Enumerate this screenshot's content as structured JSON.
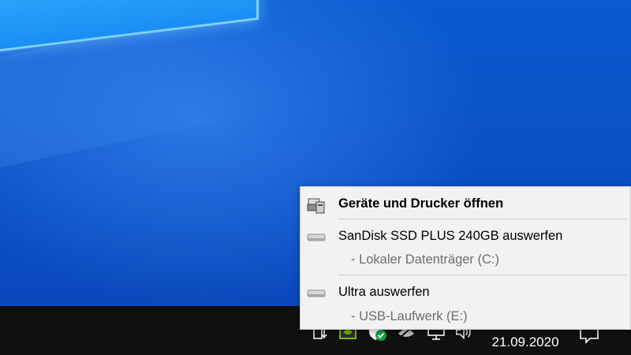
{
  "context_menu": {
    "items": [
      {
        "label": "Geräte und Drucker öffnen",
        "icon": "printer-icon"
      },
      {
        "label": "SanDisk SSD PLUS 240GB auswerfen",
        "detail": "-   Lokaler Datenträger (C:)",
        "icon": "drive-icon"
      },
      {
        "label": "Ultra auswerfen",
        "detail": "-   USB-Laufwerk (E:)",
        "icon": "drive-icon"
      }
    ]
  },
  "taskbar": {
    "date": "21.09.2020",
    "tray_icons": [
      "usb-eject-icon",
      "nvidia-icon",
      "defender-shield-icon",
      "app-icon",
      "network-icon",
      "volume-icon"
    ]
  },
  "colors": {
    "menu_bg": "#f2f2f2",
    "taskbar_bg": "#101010",
    "desktop_blue": "#0a56c8",
    "detail_text": "#6d6d6d"
  }
}
